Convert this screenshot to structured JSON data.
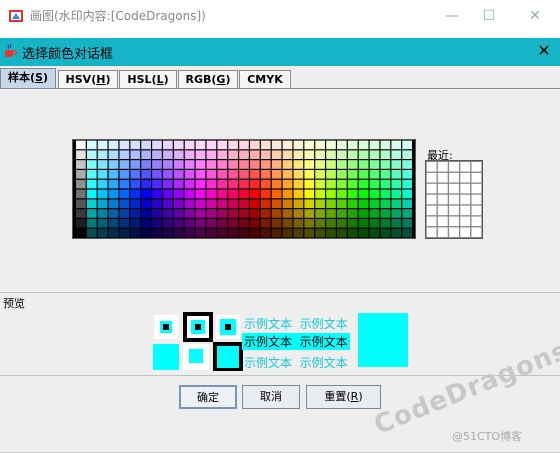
{
  "outer_window": {
    "title": "画图(水印内容:[CodeDragons])",
    "minimize": "—",
    "maximize": "☐",
    "close": "✕"
  },
  "dialog": {
    "title": "选择颜色对话框",
    "close": "✕",
    "tabs": [
      {
        "label": "样本",
        "mnemonic": "S"
      },
      {
        "label": "HSV",
        "mnemonic": "H"
      },
      {
        "label": "HSL",
        "mnemonic": "L"
      },
      {
        "label": "RGB",
        "mnemonic": "G"
      },
      {
        "label": "CMYK",
        "mnemonic": ""
      }
    ],
    "recent_label": "最近:",
    "preview_label": "预览",
    "sample_text": "示例文本",
    "buttons": {
      "ok": "确定",
      "cancel": "取消",
      "reset": "重置",
      "reset_mnemonic": "R"
    }
  },
  "colors": {
    "accent": "#15b4c6",
    "selected": "#00ffff",
    "dark": "#000000",
    "light": "#ffffff"
  },
  "watermark": "CodeDragons",
  "credit": "@51CTO博客"
}
